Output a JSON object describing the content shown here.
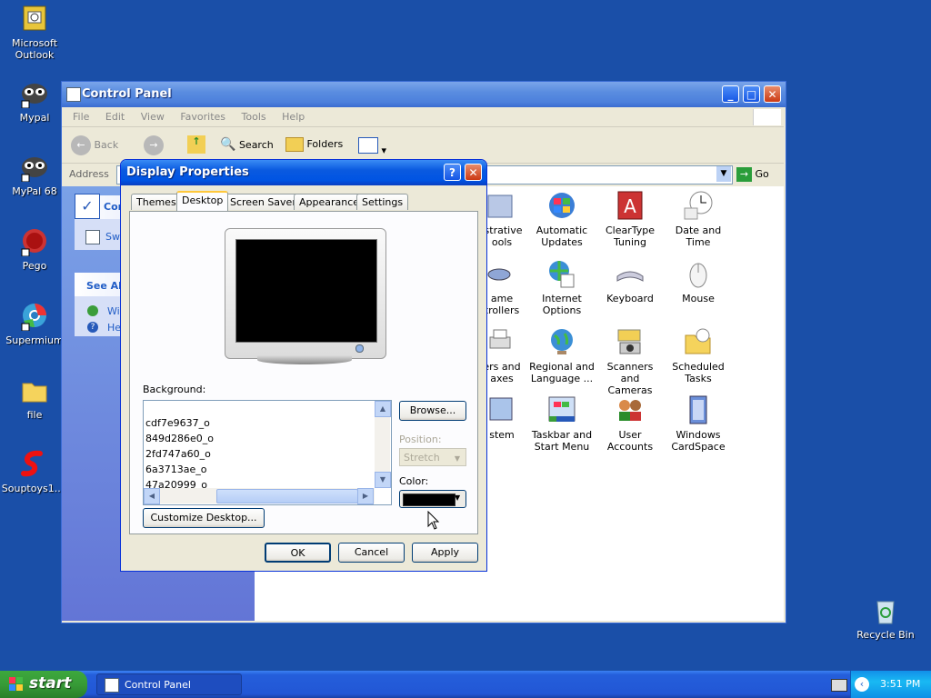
{
  "desktop": {
    "icons": [
      {
        "label": "Microsoft Outlook",
        "icon": "outlook-icon"
      },
      {
        "label": "Mypal",
        "icon": "mypal-icon"
      },
      {
        "label": "MyPal 68",
        "icon": "mypal-icon"
      },
      {
        "label": "Pego",
        "icon": "pego-icon"
      },
      {
        "label": "Supermium",
        "icon": "supermium-icon"
      },
      {
        "label": "file",
        "icon": "folder-icon"
      },
      {
        "label": "Souptoys1...",
        "icon": "souptoys-icon"
      }
    ],
    "recycle_bin": "Recycle Bin"
  },
  "control_panel": {
    "title": "Control Panel",
    "menu": [
      "File",
      "Edit",
      "View",
      "Favorites",
      "Tools",
      "Help"
    ],
    "toolbar": {
      "back": "Back",
      "search": "Search",
      "folders": "Folders"
    },
    "address_label": "Address",
    "go_label": "Go",
    "side": {
      "panel_title": "Cont",
      "switch_label": "Sw",
      "see_also": "See Als",
      "link1": "Wi",
      "link2": "He"
    },
    "items": [
      {
        "line1": "istrative",
        "line2": "ools"
      },
      {
        "line1": "Automatic",
        "line2": "Updates"
      },
      {
        "line1": "ClearType",
        "line2": "Tuning"
      },
      {
        "line1": "Date and Time",
        "line2": ""
      },
      {
        "line1": "ame",
        "line2": "trollers"
      },
      {
        "line1": "Internet",
        "line2": "Options"
      },
      {
        "line1": "Keyboard",
        "line2": ""
      },
      {
        "line1": "Mouse",
        "line2": ""
      },
      {
        "line1": "ers and",
        "line2": "axes"
      },
      {
        "line1": "Regional and",
        "line2": "Language ..."
      },
      {
        "line1": "Scanners and",
        "line2": "Cameras"
      },
      {
        "line1": "Scheduled",
        "line2": "Tasks"
      },
      {
        "line1": "stem",
        "line2": ""
      },
      {
        "line1": "Taskbar and",
        "line2": "Start Menu"
      },
      {
        "line1": "User Accounts",
        "line2": ""
      },
      {
        "line1": "Windows",
        "line2": "CardSpace"
      }
    ]
  },
  "display_properties": {
    "title": "Display Properties",
    "tabs": [
      "Themes",
      "Desktop",
      "Screen Saver",
      "Appearance",
      "Settings"
    ],
    "active_tab": "Desktop",
    "background_label": "Background:",
    "background_items": [
      "cdf7e9637_o",
      "849d286e0_o",
      "2fd747a60_o",
      "6a3713ae_o",
      "47a20999_o"
    ],
    "browse_button": "Browse...",
    "position_label": "Position:",
    "position_value": "Stretch",
    "color_label": "Color:",
    "color_value": "#000000",
    "customize_button": "Customize Desktop...",
    "ok_button": "OK",
    "cancel_button": "Cancel",
    "apply_button": "Apply"
  },
  "taskbar": {
    "start": "start",
    "task": "Control Panel",
    "clock": "3:51 PM"
  }
}
